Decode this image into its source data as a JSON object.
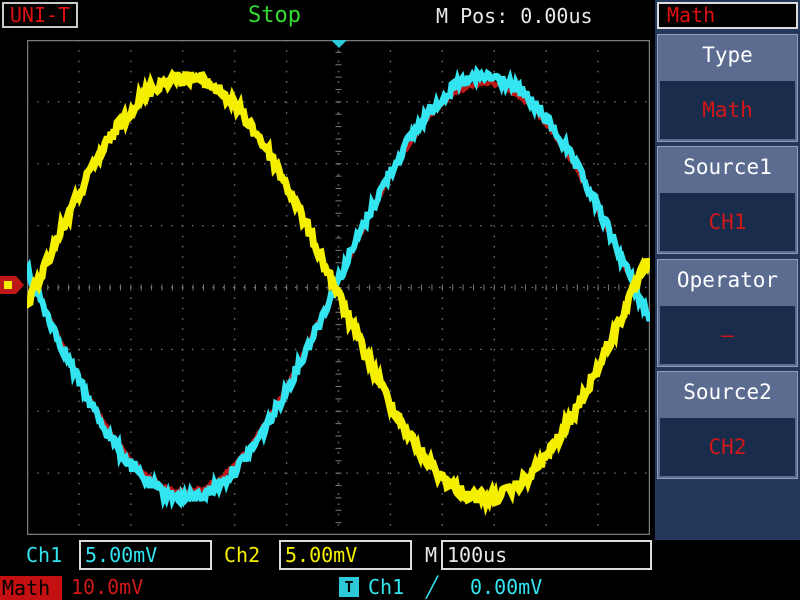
{
  "header": {
    "brand": "UNI-T",
    "status": "Stop",
    "m_pos": "M Pos: 0.00us"
  },
  "menu": {
    "title": "Math",
    "items": [
      {
        "label": "Type",
        "value": "Math"
      },
      {
        "label": "Source1",
        "value": "CH1"
      },
      {
        "label": "Operator",
        "value": "—"
      },
      {
        "label": "Source2",
        "value": "CH2"
      }
    ]
  },
  "bottom": {
    "ch1_label": "Ch1",
    "ch1_scale": "5.00mV",
    "ch2_label": "Ch2",
    "ch2_scale": "5.00mV",
    "time_label": "M",
    "timebase": "100us",
    "math_label": "Math",
    "math_scale": "10.0mV",
    "trigger_icon": "T",
    "trigger_source": "Ch1",
    "trigger_slope": "╱",
    "trigger_level": "0.00mV"
  },
  "colors": {
    "ch1": "#33e5f0",
    "ch2": "#f5f000",
    "math": "#c01818",
    "grid": "#7a7a7a",
    "menu_bg": "#23385a"
  },
  "waveforms": {
    "ch1": {
      "amplitude_div": 3.4,
      "cycles": 1,
      "phase": "inverted-sine"
    },
    "ch2": {
      "amplitude_div": 3.4,
      "cycles": 1,
      "phase": "sine"
    },
    "math": {
      "amplitude_div": 3.3,
      "cycles": 1,
      "phase": "inverted-sine"
    }
  }
}
